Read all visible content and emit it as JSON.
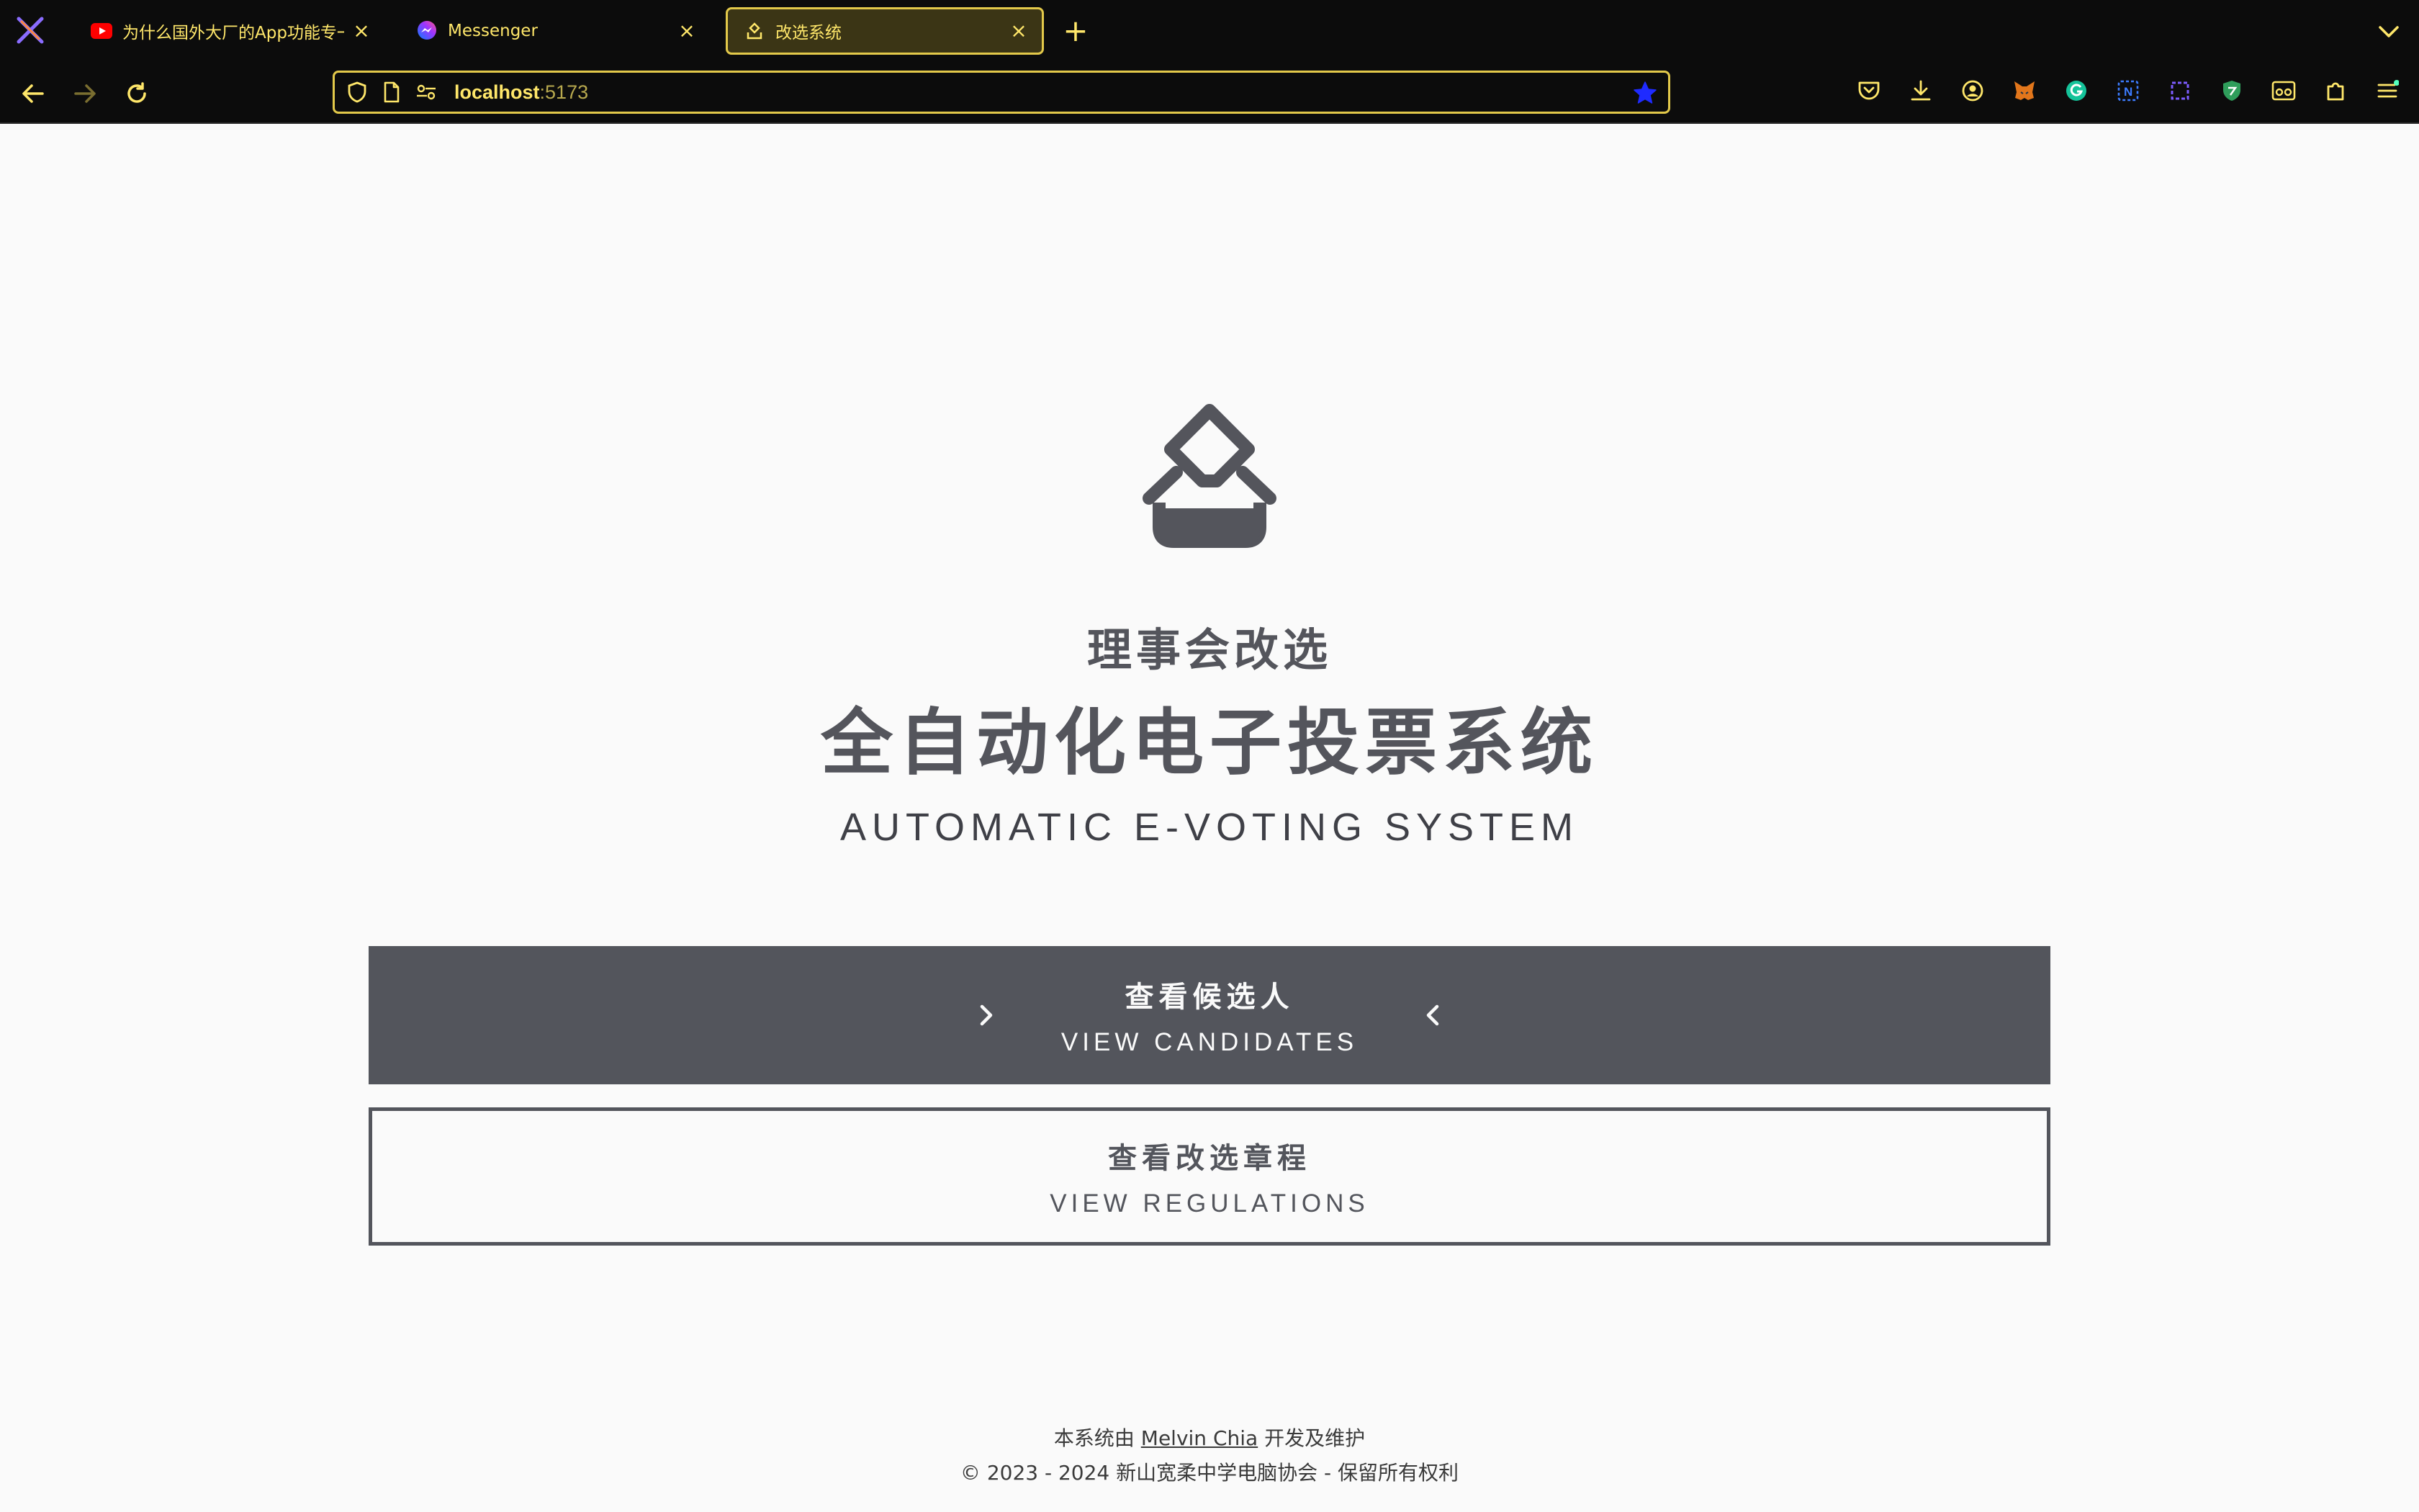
{
  "browser": {
    "tabs": [
      {
        "title": "为什么国外大厂的App功能专一而",
        "favicon": "youtube-icon",
        "active": false
      },
      {
        "title": "Messenger",
        "favicon": "messenger-icon",
        "active": false
      },
      {
        "title": "改选系统",
        "favicon": "ballot-icon",
        "active": true
      }
    ],
    "url": {
      "host": "localhost",
      "port": ":5173"
    },
    "accent_color": "#e3c94a",
    "text_color": "#ffe76a",
    "extensions": [
      "pocket-icon",
      "download-icon",
      "account-icon",
      "metamask-icon",
      "grammarly-icon",
      "notion-icon",
      "screenshot-icon",
      "shield-extension-icon",
      "reader-icon",
      "extensions-icon",
      "menu-icon"
    ]
  },
  "page": {
    "subtitle": "理事会改选",
    "title": "全自动化电子投票系统",
    "title_en": "AUTOMATIC E-VOTING SYSTEM",
    "primary_button": {
      "cn": "查看候选人",
      "en": "VIEW CANDIDATES"
    },
    "secondary_button": {
      "cn": "查看改选章程",
      "en": "VIEW REGULATIONS"
    },
    "footer": {
      "line1_prefix": "本系统由",
      "author": "Melvin Chia",
      "line1_suffix": "开发及维护",
      "line2": "© 2023 - 2024 新山宽柔中学电脑协会 - 保留所有权利"
    },
    "theme_color": "#53555c",
    "background": "#fafafa"
  }
}
